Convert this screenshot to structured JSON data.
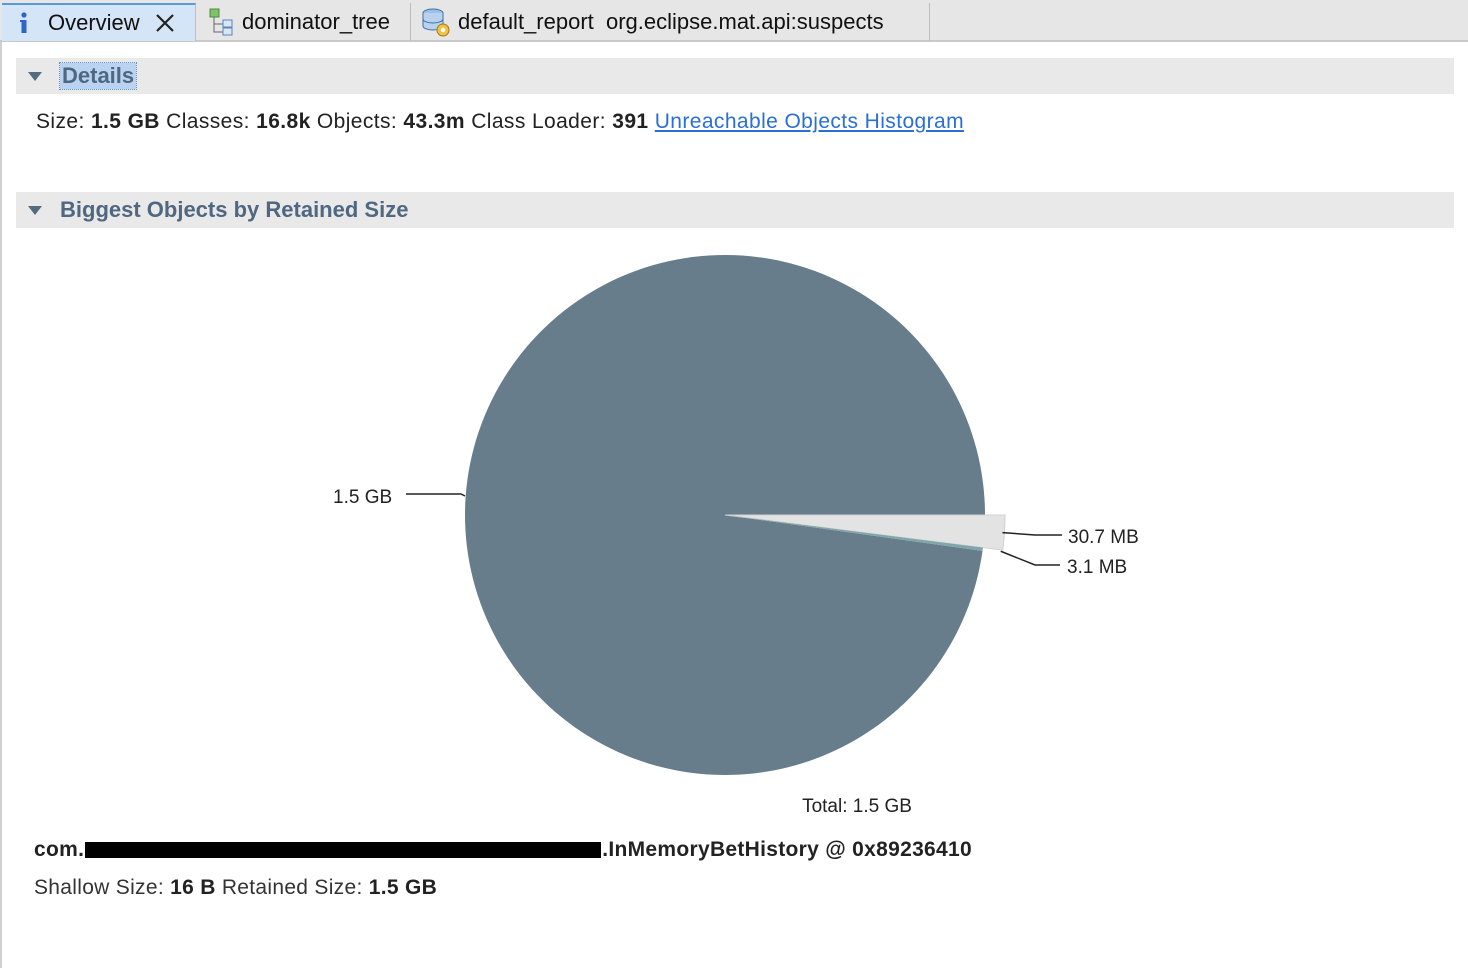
{
  "tabs": [
    {
      "label": "Overview",
      "icon": "info-icon",
      "active": true,
      "closable": true
    },
    {
      "label": "dominator_tree",
      "icon": "tree-icon",
      "active": false
    },
    {
      "label": "default_report  org.eclipse.mat.api:suspects",
      "icon": "report-icon",
      "active": false
    }
  ],
  "details": {
    "title": "Details",
    "size_label": "Size:",
    "size_value": "1.5 GB",
    "classes_label": "Classes:",
    "classes_value": "16.8k",
    "objects_label": "Objects:",
    "objects_value": "43.3m",
    "classloader_label": "Class Loader:",
    "classloader_value": "391",
    "link_label": "Unreachable Objects Histogram"
  },
  "biggest": {
    "title": "Biggest Objects by Retained Size"
  },
  "chart_data": {
    "type": "pie",
    "slices": [
      {
        "label": "1.5 GB",
        "value": 1500,
        "color": "#687d8c"
      },
      {
        "label": "30.7 MB",
        "value": 30.7,
        "color": "#e3e3e3"
      },
      {
        "label": "3.1 MB",
        "value": 3.1,
        "color": "#7fa7a9"
      }
    ],
    "total_label": "Total: 1.5 GB"
  },
  "object": {
    "name_prefix": "com.",
    "name_suffix": ".InMemoryBetHistory @ 0x89236410",
    "shallow_label": "Shallow Size:",
    "shallow_value": "16 B",
    "retained_label": "Retained Size:",
    "retained_value": "1.5 GB"
  }
}
